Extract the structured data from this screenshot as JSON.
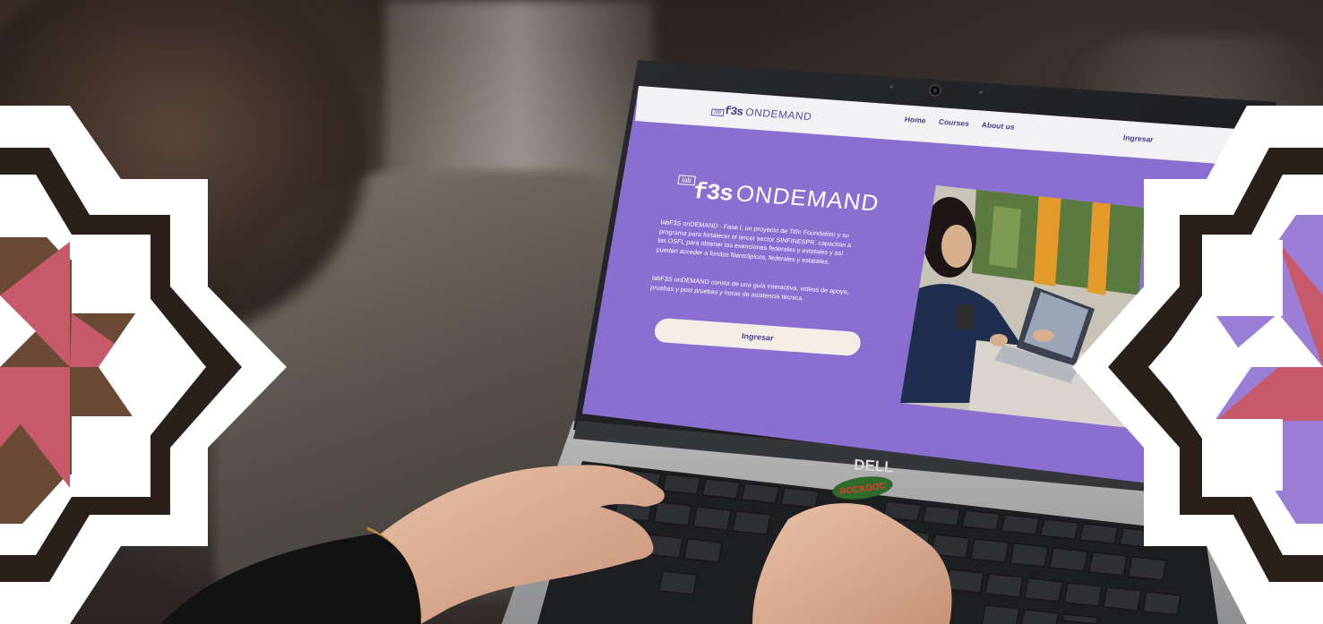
{
  "site": {
    "nav_logo": {
      "prefix": "lab",
      "brand": "f3s",
      "suffix": "ONDEMAND"
    },
    "nav": [
      "Home",
      "Courses",
      "About us"
    ],
    "login_link": "Ingresar",
    "hero_logo": {
      "prefix": "lab",
      "brand": "f3s",
      "suffix": "ONDEMAND"
    },
    "paragraph1_lines": [
      "labF3S onDEMAND - Fase I, un proyecto de Titîn Foundation y su",
      "programa para fortalecer el tercer sector SINFINESPR, capacitan a",
      "las OSFL para obtener las exenciones federales y estatales y así",
      "puedan acceder a fondos filantrópicos, federales y estatales."
    ],
    "paragraph2_lines": [
      "labF3S onDEMAND consta de una guía interactiva, videos de apoyo,",
      "pruebas y post pruebas y horas de asistencia técnica."
    ],
    "cta_button": "Ingresar"
  },
  "laptop": {
    "brand_logo": "DELL",
    "sticker": "ROCKDOC"
  },
  "colors": {
    "screen_purple": "#8a6fd0",
    "header_bg": "#f2f1f4",
    "ornament_pink": "#c65a6a",
    "ornament_brown": "#6b4a35",
    "ornament_lilac": "#9b7fd6"
  },
  "icons": [
    "webcam-icon",
    "keyboard-icon",
    "star-ornament-icon"
  ]
}
